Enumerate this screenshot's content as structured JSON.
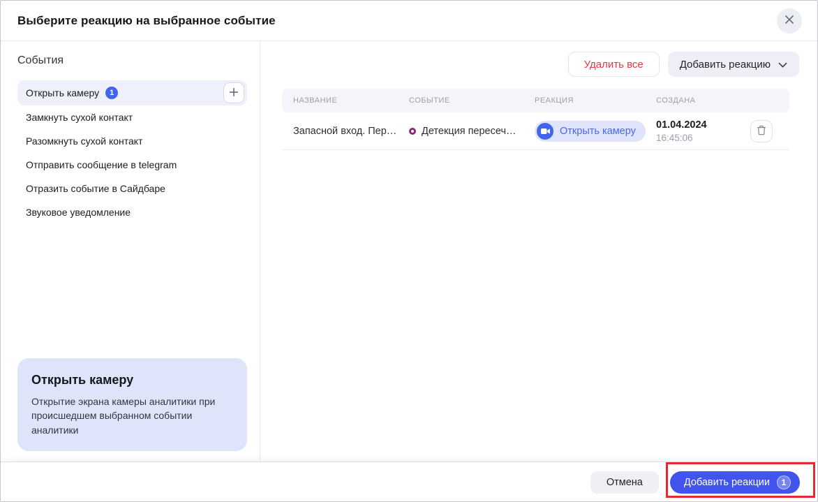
{
  "dialog": {
    "title": "Выберите реакцию на выбранное событие"
  },
  "sidebar": {
    "header": "События",
    "items": [
      {
        "label": "Открыть камеру",
        "badge": "1",
        "selected": true
      },
      {
        "label": "Замкнуть сухой контакт"
      },
      {
        "label": "Разомкнуть сухой контакт"
      },
      {
        "label": "Отправить сообщение в telegram"
      },
      {
        "label": "Отразить событие в Сайдбаре"
      },
      {
        "label": "Звуковое уведомление"
      }
    ],
    "info_card": {
      "title": "Открыть камеру",
      "description": "Открытие экрана камеры аналитики при происшедшем выбранном событии аналитики"
    }
  },
  "toolbar": {
    "delete_all_label": "Удалить все",
    "add_reaction_label": "Добавить реакцию"
  },
  "table": {
    "columns": [
      "НАЗВАНИЕ",
      "СОБЫТИЕ",
      "РЕАКЦИЯ",
      "СОЗДАНА"
    ],
    "rows": [
      {
        "name": "Запасной вход. Пере…",
        "event": "Детекция пересеч…",
        "reaction": "Открыть камеру",
        "created_date": "01.04.2024",
        "created_time": "16:45:06"
      }
    ]
  },
  "footer": {
    "cancel_label": "Отмена",
    "submit_label": "Добавить реакции",
    "submit_badge": "1"
  },
  "colors": {
    "accent_blue": "#4254EE",
    "selected_item_bg": "#EEF1FB",
    "info_card_bg": "#DEE4FA",
    "reaction_pill_bg": "#DFE4FB",
    "reaction_pill_text": "#4B66F0",
    "delete_all_text": "#E5383B",
    "annotation_red": "#DF2B33",
    "event_ring": "#8A2A6C",
    "table_header_bg": "#F4F4F9"
  }
}
